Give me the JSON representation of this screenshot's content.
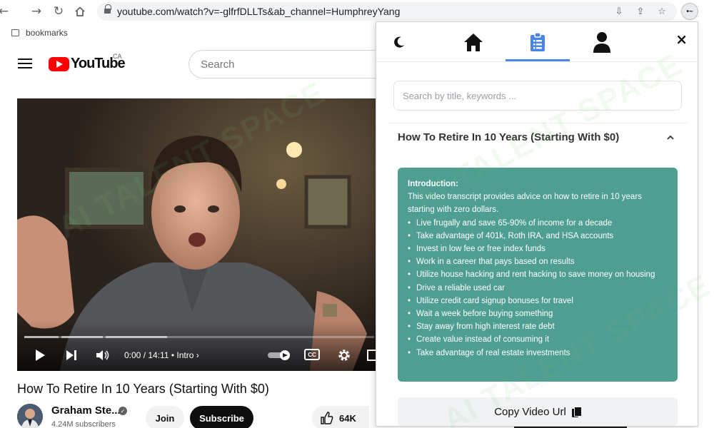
{
  "browser": {
    "url": "youtube.com/watch?v=-glfrfDLLTs&ab_channel=HumphreyYang",
    "bookmarks_label": "bookmarks",
    "extension_badge": "•~"
  },
  "youtube": {
    "logo_text": "YouTube",
    "country_code": "CA",
    "search_placeholder": "Search",
    "player": {
      "time": "0:00 / 14:11",
      "chapter": "Intro",
      "chapter_arrow": "›",
      "cc_label": "CC",
      "progress_fraction": 0.0
    },
    "video_title": "How To Retire In 10 Years (Starting With $0)",
    "channel_name": "Graham Ste...",
    "subscribers": "4.24M subscribers",
    "join_label": "Join",
    "subscribe_label": "Subscribe",
    "likes": "64K"
  },
  "panel": {
    "close_label": "×",
    "active_tab": "summary",
    "search_placeholder": "Search by title, keywords ...",
    "accordion_title": "How To Retire In 10 Years (Starting With $0)",
    "summary": {
      "heading": "Introduction:",
      "intro": "This video transcript provides advice on how to retire in 10 years starting with zero dollars.",
      "bullets": [
        "Live frugally and save 65-90% of income for a decade",
        "Take advantage of 401k, Roth IRA, and HSA accounts",
        "Invest in low fee or free index funds",
        "Work in a career that pays based on results",
        "Utilize house hacking and rent hacking to save money on housing",
        "Drive a reliable used car",
        "Utilize credit card signup bonuses for travel",
        "Wait a week before buying something",
        "Stay away from high interest rate debt",
        "Create value instead of consuming it",
        "Take advantage of real estate investments"
      ],
      "background_color": "#4e9e92"
    },
    "copy_button_label": "Copy Video Url",
    "accent_color": "#4a86e8"
  },
  "watermark_text": "AI TALENT SPACE"
}
